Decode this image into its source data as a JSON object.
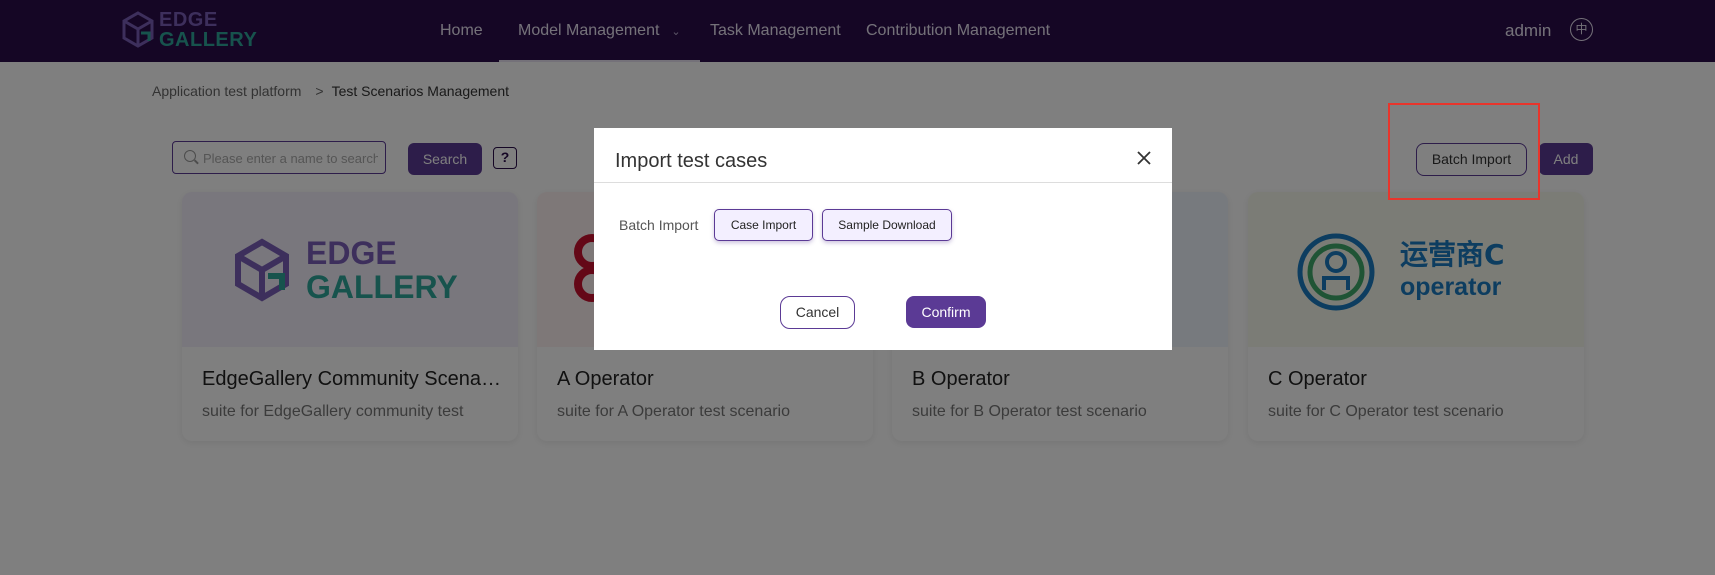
{
  "header": {
    "logo_line1": "EDGE",
    "logo_line2": "GALLERY",
    "nav": [
      {
        "label": "Home"
      },
      {
        "label": "Model Management"
      },
      {
        "label": "Task Management"
      },
      {
        "label": "Contribution Management"
      }
    ],
    "user": "admin",
    "language_icon": "中"
  },
  "breadcrumb": {
    "parent": "Application test platform",
    "current": "Test Scenarios Management"
  },
  "toolbar": {
    "search_placeholder": "Please enter a name to search",
    "search_label": "Search",
    "help_label": "?",
    "batch_import_label": "Batch Import",
    "add_label": "Add"
  },
  "cards": [
    {
      "title": "EdgeGallery Community Scenario",
      "desc": "suite for EdgeGallery community test",
      "logo_top": "EDGE",
      "logo_bottom": "GALLERY"
    },
    {
      "title": "A Operator",
      "desc": "suite for A Operator test scenario"
    },
    {
      "title": "B Operator",
      "desc": "suite for B Operator test scenario"
    },
    {
      "title": "C Operator",
      "desc": "suite for C Operator test scenario",
      "logo_top": "运营商C",
      "logo_bottom": "operator"
    }
  ],
  "modal": {
    "title": "Import test cases",
    "batch_label": "Batch Import",
    "case_import_label": "Case Import",
    "sample_download_label": "Sample Download",
    "cancel_label": "Cancel",
    "confirm_label": "Confirm"
  },
  "colors": {
    "nav_bg": "#2b0d4a",
    "accent": "#5b3a95",
    "highlight": "#e8352c"
  }
}
